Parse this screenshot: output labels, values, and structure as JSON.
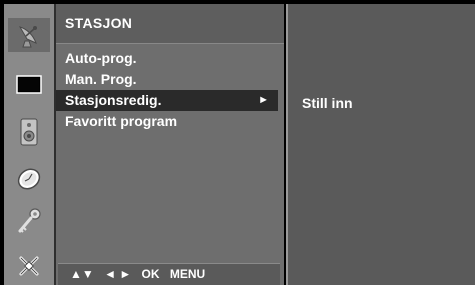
{
  "menu": {
    "title": "STASJON",
    "items": [
      {
        "label": "Auto-prog.",
        "selected": false,
        "arrow": ""
      },
      {
        "label": "Man. Prog.",
        "selected": false,
        "arrow": ""
      },
      {
        "label": "Stasjonsredig.",
        "selected": true,
        "arrow": "►"
      },
      {
        "label": "Favoritt program",
        "selected": false,
        "arrow": ""
      }
    ],
    "footer": {
      "updown": "▲▼",
      "leftright": "◄ ►",
      "ok": "OK",
      "menu": "MENU"
    }
  },
  "submenu": {
    "item": "Still inn"
  },
  "sidebar": {
    "icons": [
      "satellite-dish-icon",
      "screen-icon",
      "speaker-icon",
      "clock-icon",
      "key-icon",
      "settings-icon"
    ],
    "selected_index": 0
  },
  "colors": {
    "sidebar_bg": "#8a8a8a",
    "menu_bg": "#6e6e6e",
    "title_bg": "#5e5e5e",
    "selected_row": "#2a2a2a",
    "submenu_bg": "#5a5a5a",
    "text": "#ffffff"
  }
}
